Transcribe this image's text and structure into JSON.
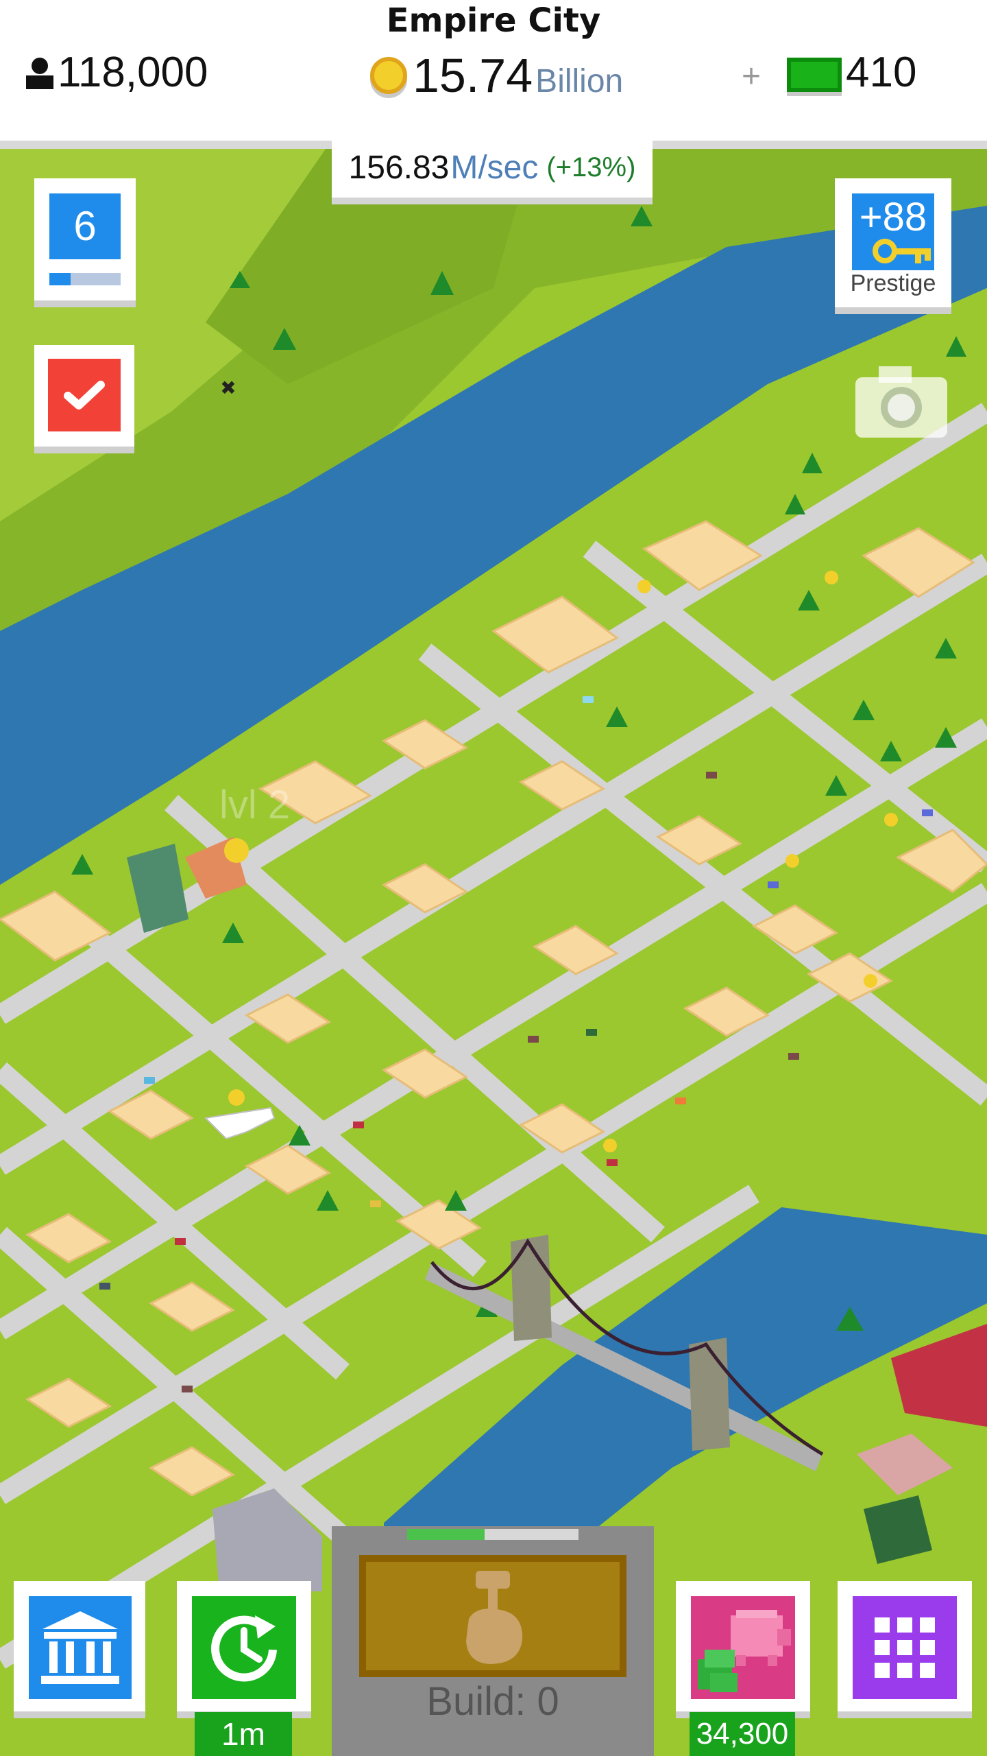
{
  "header": {
    "city_name": "Empire City",
    "population": "118,000",
    "coins_value": "15.74",
    "coins_unit": "Billion",
    "plus": "+",
    "gems": "410"
  },
  "income": {
    "value": "156.83",
    "unit": "M/sec",
    "bonus": "(+13%)"
  },
  "level": {
    "number": "6",
    "progress": 0.3
  },
  "prestige": {
    "value": "+88",
    "label": "Prestige"
  },
  "map": {
    "plot_label": "lvl 2"
  },
  "bottom": {
    "timer_label": "1m",
    "piggy_label": "34,300",
    "build_label": "Build: 0",
    "build_progress": 0.45
  },
  "colors": {
    "blue": "#1f8ceb",
    "green": "#19b31d",
    "red": "#f24137",
    "purple": "#9a3cec",
    "pink": "#d93c85",
    "gold": "#f3cf2b"
  },
  "icons": [
    "person-icon",
    "coin-icon",
    "gem-icon",
    "check-icon",
    "key-icon",
    "camera-icon",
    "museum-icon",
    "clock-refresh-icon",
    "piggy-bank-icon",
    "grid-icon",
    "hammer-hand-icon"
  ]
}
